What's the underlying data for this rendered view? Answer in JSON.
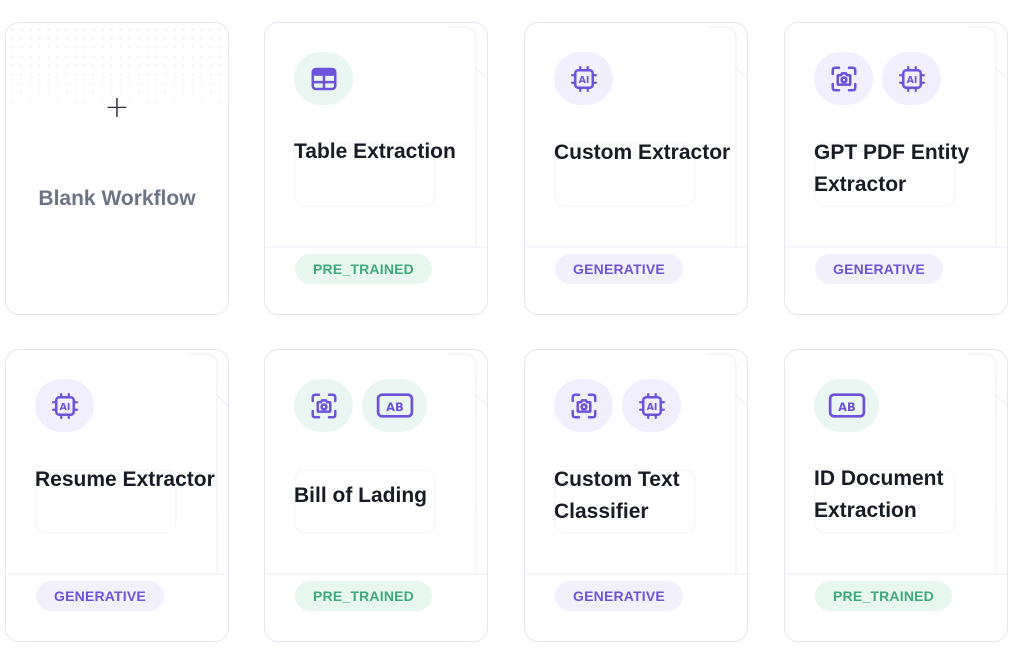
{
  "colors": {
    "accent_purple": "#6d52dc",
    "icon_bg_purple": "#f1eefe",
    "icon_bg_teal": "#e9f6f1",
    "badge_pre_text": "#3fa97d",
    "card_border": "#e3e6ec"
  },
  "blank": {
    "plus": "+",
    "title": "Blank Workflow"
  },
  "cards": [
    {
      "title": "Table Extraction",
      "badge": "PRE_TRAINED",
      "icons": [
        "table-icon"
      ]
    },
    {
      "title": "Custom Extractor",
      "badge": "GENERATIVE",
      "icons": [
        "ai-chip-icon"
      ]
    },
    {
      "title": "GPT PDF Entity Extractor",
      "badge": "GENERATIVE",
      "icons": [
        "camera-scan-icon",
        "ai-chip-icon"
      ]
    },
    {
      "title": "Resume Extractor",
      "badge": "GENERATIVE",
      "icons": [
        "ai-chip-icon"
      ]
    },
    {
      "title": "Bill of Lading",
      "badge": "PRE_TRAINED",
      "icons": [
        "camera-scan-icon",
        "ab-text-icon"
      ]
    },
    {
      "title": "Custom Text Classifier",
      "badge": "GENERATIVE",
      "icons": [
        "camera-scan-icon",
        "ai-chip-icon"
      ]
    },
    {
      "title": "ID Document Extraction",
      "badge": "PRE_TRAINED",
      "icons": [
        "ab-text-icon"
      ]
    }
  ]
}
